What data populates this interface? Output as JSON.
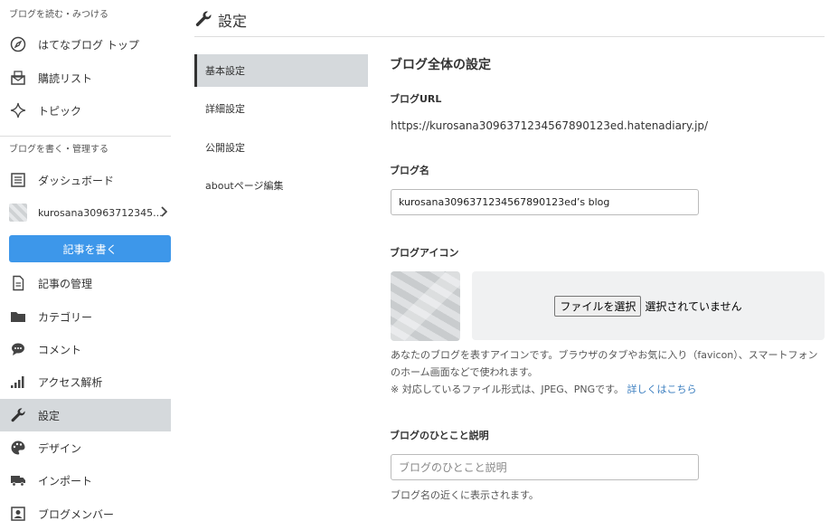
{
  "sidebar": {
    "read_heading": "ブログを読む・みつける",
    "read_items": [
      {
        "label": "はてなブログ トップ",
        "icon": "compass-icon"
      },
      {
        "label": "購読リスト",
        "icon": "subscription-icon"
      },
      {
        "label": "トピック",
        "icon": "sparkle-icon"
      }
    ],
    "manage_heading": "ブログを書く・管理する",
    "dashboard_label": "ダッシュボード",
    "blog_name": "kurosana30963712345...",
    "write_button": "記事を書く",
    "manage_items": [
      {
        "label": "記事の管理",
        "icon": "document-icon"
      },
      {
        "label": "カテゴリー",
        "icon": "folder-icon"
      },
      {
        "label": "コメント",
        "icon": "comment-icon"
      },
      {
        "label": "アクセス解析",
        "icon": "signal-bars-icon"
      },
      {
        "label": "設定",
        "icon": "wrench-icon",
        "active": true
      },
      {
        "label": "デザイン",
        "icon": "palette-icon"
      },
      {
        "label": "インポート",
        "icon": "truck-icon"
      },
      {
        "label": "ブログメンバー",
        "icon": "member-icon"
      }
    ]
  },
  "header": {
    "title": "設定",
    "icon": "wrench-icon"
  },
  "subnav": {
    "items": [
      "基本設定",
      "詳細設定",
      "公開設定",
      "aboutページ編集"
    ],
    "active": "基本設定"
  },
  "main": {
    "section_title": "ブログ全体の設定",
    "url_label": "ブログURL",
    "url_value": "https://kurosana3096371234567890123ed.hatenadiary.jp/",
    "name_label": "ブログ名",
    "name_value": "kurosana3096371234567890123ed’s blog",
    "icon_label": "ブログアイコン",
    "file_button": "ファイルを選択",
    "file_status": "選択されていません",
    "icon_help_line1": "あなたのブログを表すアイコンです。ブラウザのタブやお気に入り（favicon）、スマートフォン",
    "icon_help_line2": "のホーム画面などで使われます。",
    "icon_help_line3": "※ 対応しているファイル形式は、JPEG、PNGです。",
    "icon_help_link": "詳しくはこちら",
    "desc_label": "ブログのひとこと説明",
    "desc_placeholder": "ブログのひとこと説明",
    "desc_help": "ブログ名の近くに表示されます。"
  },
  "colors": {
    "accent": "#3d97ea",
    "active_bg": "#d5d9dc",
    "link": "#3c7fc0"
  }
}
